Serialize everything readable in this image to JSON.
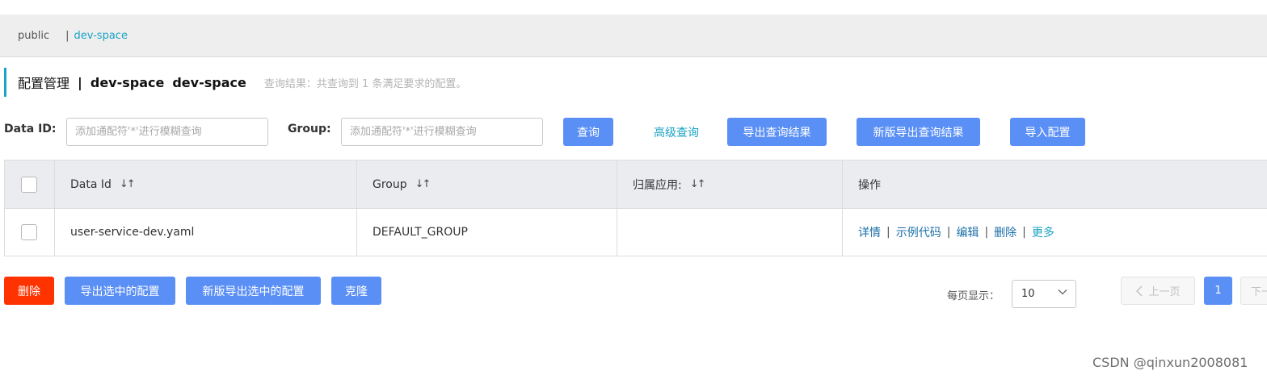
{
  "namespace_bar": {
    "items": [
      "public",
      "dev-space"
    ],
    "separator": "|",
    "active": "dev-space"
  },
  "title": {
    "main": "配置管理",
    "pipe": "|",
    "namespace_name": "dev-space",
    "namespace_id": "dev-space",
    "result_text": "查询结果：共查询到 1 条满足要求的配置。"
  },
  "filters": {
    "data_id_label": "Data ID:",
    "data_id_placeholder": "添加通配符'*'进行模糊查询",
    "group_label": "Group:",
    "group_placeholder": "添加通配符'*'进行模糊查询",
    "query_button": "查询",
    "advanced_query": "高级查询",
    "export_query_result": "导出查询结果",
    "new_export_query_result": "新版导出查询结果",
    "import_config": "导入配置"
  },
  "table": {
    "headers": {
      "data_id": "Data Id",
      "group": "Group",
      "app": "归属应用:",
      "ops": "操作"
    },
    "sort_icon": "sort-icon",
    "rows": [
      {
        "data_id": "user-service-dev.yaml",
        "group": "DEFAULT_GROUP",
        "app": "",
        "ops": [
          "详情",
          "示例代码",
          "编辑",
          "删除",
          "更多"
        ]
      }
    ]
  },
  "bulk_actions": {
    "delete": "删除",
    "export_selected": "导出选中的配置",
    "new_export_selected": "新版导出选中的配置",
    "clone": "克隆"
  },
  "pagination": {
    "page_size_label": "每页显示：",
    "page_size": "10",
    "prev": "上一页",
    "current_page": "1",
    "next": "下一页"
  },
  "watermark": "CSDN @qinxun2008081",
  "colors": {
    "primary": "#5a8ff5",
    "danger": "#ff3300",
    "accent": "#19a3c4"
  }
}
